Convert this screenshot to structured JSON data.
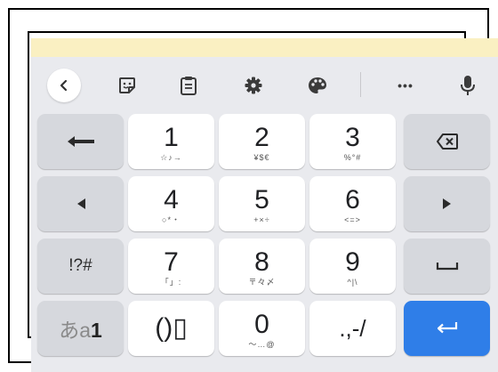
{
  "toolbar": {
    "icons": [
      "chevron-left-icon",
      "sticker-icon",
      "clipboard-icon",
      "gear-icon",
      "palette-icon",
      "more-icon",
      "mic-icon"
    ],
    "more_label": "•••"
  },
  "keys": {
    "row1": {
      "k1_main": "1",
      "k1_sub": "☆♪→",
      "k2_main": "2",
      "k2_sub": "¥$€",
      "k3_main": "3",
      "k3_sub": "%°#"
    },
    "row2": {
      "k4_main": "4",
      "k4_sub": "○*・",
      "k5_main": "5",
      "k5_sub": "+×÷",
      "k6_main": "6",
      "k6_sub": "<=>"
    },
    "row3": {
      "sym": "!?#",
      "k7_main": "7",
      "k7_sub": "「」:",
      "k8_main": "8",
      "k8_sub": "〒々〆",
      "k9_main": "9",
      "k9_sub": "^|\\"
    },
    "row4": {
      "mode_a": "あ",
      "mode_b": "a",
      "mode_c": "1",
      "brackets": "()▯",
      "k0_main": "0",
      "k0_sub": "〜…@",
      "punct": ".,-/"
    }
  },
  "colors": {
    "strip": "#faf0c2",
    "keyboard_bg": "#e9eaee",
    "fn_key": "#d6d8dd",
    "enter": "#2f7ee8"
  }
}
